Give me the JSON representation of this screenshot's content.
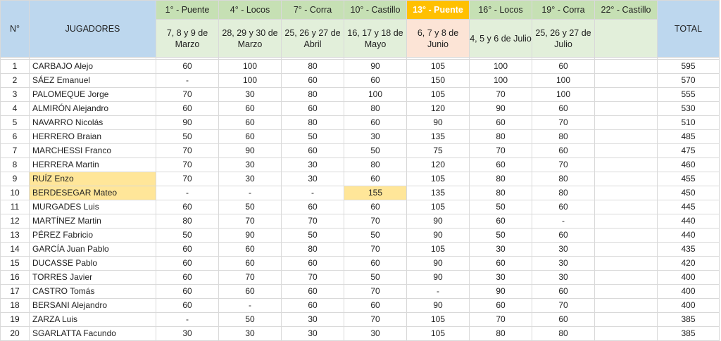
{
  "header": {
    "num_label": "N°",
    "players_label": "JUGADORES",
    "total_label": "TOTAL",
    "events": [
      {
        "name": "1° - Puente",
        "dates": "7, 8 y 9 de Marzo"
      },
      {
        "name": "4° - Locos",
        "dates": "28, 29 y 30 de Marzo"
      },
      {
        "name": "7° - Corra",
        "dates": "25, 26 y 27 de Abril"
      },
      {
        "name": "10° - Castillo",
        "dates": "16, 17 y 18 de Mayo"
      },
      {
        "name": "13° - Puente",
        "dates": "6, 7 y 8 de Junio"
      },
      {
        "name": "16° - Locos",
        "dates": "4, 5 y 6 de Julio"
      },
      {
        "name": "19° - Corra",
        "dates": "25, 26 y 27 de Julio"
      },
      {
        "name": "22° - Castillo",
        "dates": ""
      }
    ]
  },
  "rows": [
    {
      "n": "1",
      "player": "CARBAJO Alejo",
      "scores": [
        "60",
        "100",
        "80",
        "90",
        "105",
        "100",
        "60",
        ""
      ],
      "total": "595"
    },
    {
      "n": "2",
      "player": "SÁEZ Emanuel",
      "scores": [
        "-",
        "100",
        "60",
        "60",
        "150",
        "100",
        "100",
        ""
      ],
      "total": "570"
    },
    {
      "n": "3",
      "player": "PALOMEQUE Jorge",
      "scores": [
        "70",
        "30",
        "80",
        "100",
        "105",
        "70",
        "100",
        ""
      ],
      "total": "555"
    },
    {
      "n": "4",
      "player": "ALMIRÓN Alejandro",
      "scores": [
        "60",
        "60",
        "60",
        "80",
        "120",
        "90",
        "60",
        ""
      ],
      "total": "530"
    },
    {
      "n": "5",
      "player": "NAVARRO Nicolás",
      "scores": [
        "90",
        "60",
        "80",
        "60",
        "90",
        "60",
        "70",
        ""
      ],
      "total": "510"
    },
    {
      "n": "6",
      "player": "HERRERO Braian",
      "scores": [
        "50",
        "60",
        "50",
        "30",
        "135",
        "80",
        "80",
        ""
      ],
      "total": "485"
    },
    {
      "n": "7",
      "player": "MARCHESSI Franco",
      "scores": [
        "70",
        "90",
        "60",
        "50",
        "75",
        "70",
        "60",
        ""
      ],
      "total": "475"
    },
    {
      "n": "8",
      "player": "HERRERA Martin",
      "scores": [
        "70",
        "30",
        "30",
        "80",
        "120",
        "60",
        "70",
        ""
      ],
      "total": "460"
    },
    {
      "n": "9",
      "player": "RUÍZ Enzo",
      "scores": [
        "70",
        "30",
        "30",
        "60",
        "105",
        "80",
        "80",
        ""
      ],
      "total": "455"
    },
    {
      "n": "10",
      "player": "BERDESEGAR Mateo",
      "scores": [
        "-",
        "-",
        "-",
        "155",
        "135",
        "80",
        "80",
        ""
      ],
      "total": "450"
    },
    {
      "n": "11",
      "player": "MURGADES Luis",
      "scores": [
        "60",
        "50",
        "60",
        "60",
        "105",
        "50",
        "60",
        ""
      ],
      "total": "445"
    },
    {
      "n": "12",
      "player": "MARTÍNEZ Martin",
      "scores": [
        "80",
        "70",
        "70",
        "70",
        "90",
        "60",
        "-",
        ""
      ],
      "total": "440"
    },
    {
      "n": "13",
      "player": "PÉREZ Fabricio",
      "scores": [
        "50",
        "90",
        "50",
        "50",
        "90",
        "50",
        "60",
        ""
      ],
      "total": "440"
    },
    {
      "n": "14",
      "player": "GARCÍA Juan Pablo",
      "scores": [
        "60",
        "60",
        "80",
        "70",
        "105",
        "30",
        "30",
        ""
      ],
      "total": "435"
    },
    {
      "n": "15",
      "player": "DUCASSE Pablo",
      "scores": [
        "60",
        "60",
        "60",
        "60",
        "90",
        "60",
        "30",
        ""
      ],
      "total": "420"
    },
    {
      "n": "16",
      "player": "TORRES Javier",
      "scores": [
        "60",
        "70",
        "70",
        "50",
        "90",
        "30",
        "30",
        ""
      ],
      "total": "400"
    },
    {
      "n": "17",
      "player": "CASTRO Tomás",
      "scores": [
        "60",
        "60",
        "60",
        "70",
        "-",
        "90",
        "60",
        ""
      ],
      "total": "400"
    },
    {
      "n": "18",
      "player": "BERSANI Alejandro",
      "scores": [
        "60",
        "-",
        "60",
        "60",
        "90",
        "60",
        "70",
        ""
      ],
      "total": "400"
    },
    {
      "n": "19",
      "player": "ZARZA Luis",
      "scores": [
        "-",
        "50",
        "30",
        "70",
        "105",
        "70",
        "60",
        ""
      ],
      "total": "385"
    },
    {
      "n": "20",
      "player": "SGARLATTA Facundo",
      "scores": [
        "30",
        "30",
        "30",
        "30",
        "105",
        "80",
        "80",
        ""
      ],
      "total": "385"
    }
  ],
  "highlights": {
    "player_cells": [
      "9",
      "10"
    ],
    "score_cells": [
      {
        "row": "10",
        "col": 3
      }
    ]
  },
  "colors": {
    "header_blue": "#bdd7ee",
    "header_green": "#c6e0b4",
    "header_green_light": "#e2efda",
    "header_gold": "#ffc000",
    "header_peach": "#fce4d6",
    "highlight_yellow": "#ffe699"
  }
}
